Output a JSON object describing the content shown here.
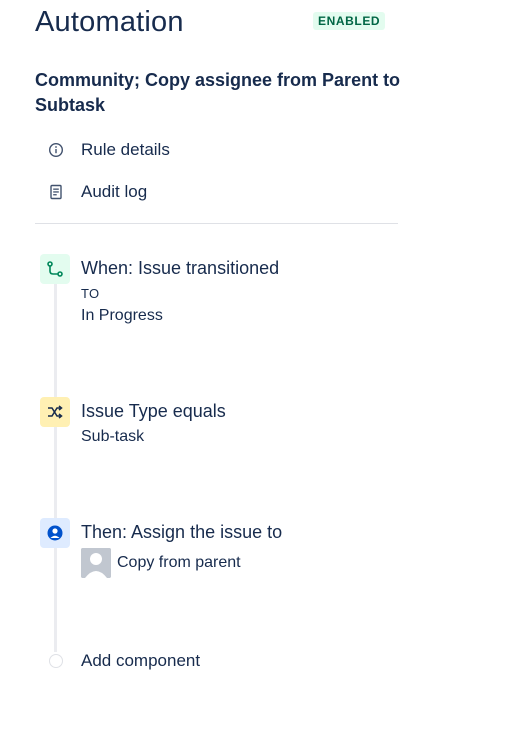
{
  "header": {
    "title": "Automation",
    "status_badge": "ENABLED"
  },
  "rule": {
    "name": "Community; Copy assignee from Parent to Subtask"
  },
  "menu": {
    "items": [
      {
        "label": "Rule details",
        "icon": "info-icon"
      },
      {
        "label": "Audit log",
        "icon": "document-icon"
      }
    ]
  },
  "steps": [
    {
      "icon": "trigger-icon",
      "color": "#e3fcef",
      "title": "When: Issue transitioned",
      "sub1": "TO",
      "sub2": "In Progress"
    },
    {
      "icon": "condition-shuffle-icon",
      "color": "#fff0b3",
      "title": "Issue Type equals",
      "sub1": "Sub-task"
    },
    {
      "icon": "action-assign-icon",
      "color": "#deebff",
      "title": "Then: Assign the issue to",
      "sub1": "Copy from parent"
    }
  ],
  "add_component": {
    "label": "Add component"
  },
  "colors": {
    "text": "#172b4d",
    "badge_bg": "#e3fcef",
    "badge_text": "#006644",
    "trigger_green": "#00875a",
    "condition_yellow_bg": "#fff0b3",
    "action_blue": "#0052cc"
  }
}
